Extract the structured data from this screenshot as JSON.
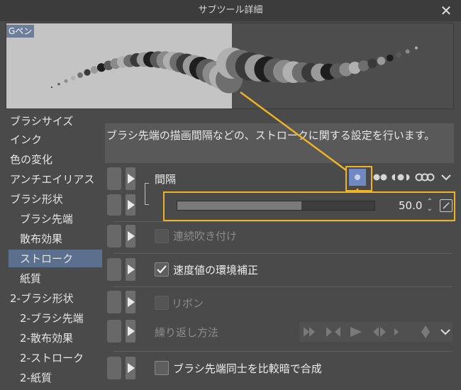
{
  "window": {
    "title": "サブツール詳細",
    "close_glyph": "✕"
  },
  "preview": {
    "brush_name": "Gペン"
  },
  "sidebar": {
    "items": [
      {
        "label": "ブラシサイズ"
      },
      {
        "label": "インク"
      },
      {
        "label": "色の変化"
      },
      {
        "label": "アンチエイリアス"
      },
      {
        "label": "ブラシ形状"
      },
      {
        "label": "ブラシ先端"
      },
      {
        "label": "散布効果"
      },
      {
        "label": "ストローク",
        "selected": true
      },
      {
        "label": "紙質"
      },
      {
        "label": "2-ブラシ形状"
      },
      {
        "label": "2-ブラシ先端"
      },
      {
        "label": "2-散布効果"
      },
      {
        "label": "2-ストローク"
      },
      {
        "label": "2-紙質"
      }
    ]
  },
  "description": "ブラシ先端の描画間隔などの、ストロークに関する設定を行います。",
  "properties": {
    "spacing": {
      "label": "間隔",
      "value": "50.0",
      "slider_fraction": 0.63
    },
    "continuous_spray": {
      "label": "連続吹き付け",
      "checked": false,
      "enabled": false
    },
    "speed_correction": {
      "label": "速度値の環境補正",
      "checked": true,
      "enabled": true
    },
    "ribbon": {
      "label": "リボン",
      "checked": false,
      "enabled": false
    },
    "repeat_method": {
      "label": "繰り返し方法",
      "enabled": false
    },
    "compare_darken": {
      "label": "ブラシ先端同士を比較暗で合成",
      "checked": false,
      "enabled": true
    }
  },
  "icons": {
    "spacing_presets": [
      "single-dot-icon",
      "double-dot-icon",
      "half-dot-icon",
      "triple-dot-icon"
    ],
    "repeat_presets": [
      "repeat-icon",
      "reverse-repeat-icon",
      "once-icon",
      "back-forth-icon",
      "diamond-icon"
    ]
  },
  "colors": {
    "highlight": "#f0b323",
    "selected_bg": "#5b6f8f",
    "preset_selected": "#7189c2"
  }
}
